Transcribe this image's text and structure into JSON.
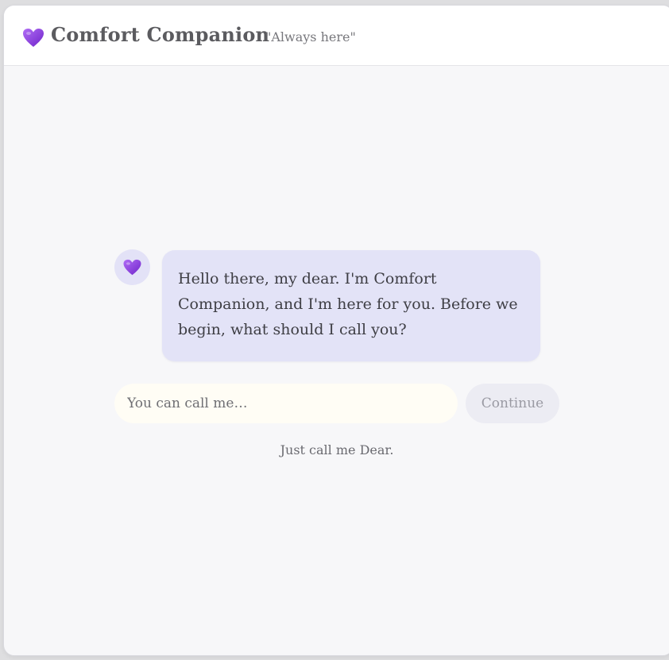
{
  "header": {
    "icon": "purple-heart-icon",
    "title": "Comfort Companion",
    "tagline": "\"Always here\""
  },
  "chat": {
    "avatar_icon": "purple-heart-icon",
    "message": "Hello there, my dear. I'm Comfort Companion, and I'm here for you. Before we begin, what should I call you?"
  },
  "form": {
    "name_value": "",
    "name_placeholder": "You can call me…",
    "continue_label": "Continue",
    "suggestion": "Just call me Dear."
  },
  "colors": {
    "accent": "#8b3fd9",
    "bubble": "#e3e3f7",
    "input_bg": "#fffdf5",
    "page_bg": "#f7f7f9"
  }
}
